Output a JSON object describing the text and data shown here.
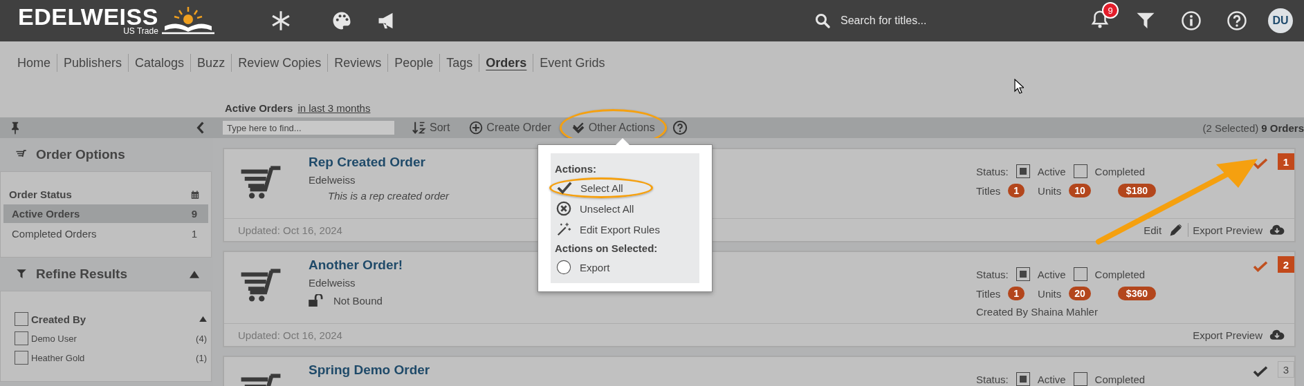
{
  "header": {
    "logo": "EDELWEISS",
    "logo_sub": "US Trade",
    "search": {
      "placeholder": "Search for titles..."
    },
    "notification_count": "9",
    "avatar": "DU"
  },
  "nav": [
    {
      "label": "Home",
      "selected": false
    },
    {
      "label": "Publishers",
      "selected": false
    },
    {
      "label": "Catalogs",
      "selected": false
    },
    {
      "label": "Buzz",
      "selected": false
    },
    {
      "label": "Review Copies",
      "selected": false
    },
    {
      "label": "Reviews",
      "selected": false
    },
    {
      "label": "People",
      "selected": false
    },
    {
      "label": "Tags",
      "selected": false
    },
    {
      "label": "Orders",
      "selected": true
    },
    {
      "label": "Event Grids",
      "selected": false
    }
  ],
  "heading": {
    "title": "Active Orders",
    "range": "in last 3 months"
  },
  "toolbar": {
    "find": {
      "placeholder": "Type here to find..."
    },
    "sort": "Sort",
    "create": "Create Order",
    "other": {
      "label": "Other Actions",
      "highlighted": true
    },
    "selected_count": "(2 Selected)",
    "total": "9 Orders"
  },
  "sidebar": {
    "order_options": "Order Options",
    "order_status": {
      "title": "Order Status",
      "items": [
        {
          "label": "Active Orders",
          "count": "9",
          "selected": true
        },
        {
          "label": "Completed Orders",
          "count": "1",
          "selected": false
        }
      ]
    },
    "refine": {
      "title": "Refine Results",
      "expanded": true,
      "groups": [
        {
          "label": "Created By",
          "checked": false,
          "expanded": true,
          "items": [
            {
              "label": "Demo User",
              "count": "(4)",
              "checked": false
            },
            {
              "label": "Heather Gold",
              "count": "(1)",
              "checked": false
            }
          ]
        }
      ]
    }
  },
  "menu": {
    "sections": [
      {
        "title": "Actions:",
        "items": [
          {
            "kind": "check",
            "label": "Select All",
            "highlighted": true
          },
          {
            "kind": "clear",
            "label": "Unselect All",
            "highlighted": false
          },
          {
            "kind": "wand",
            "label": "Edit Export Rules",
            "highlighted": false
          }
        ]
      },
      {
        "title": "Actions on Selected:",
        "items": [
          {
            "kind": "radio",
            "label": "Export",
            "highlighted": false
          }
        ]
      }
    ]
  },
  "orders": [
    {
      "title": "Rep Created Order",
      "publisher": "Edelweiss",
      "detail": {
        "kind": "note",
        "text": "This is a rep created order"
      },
      "status_label": "Status:",
      "statuses": [
        {
          "label": "Active",
          "checked": true
        },
        {
          "label": "Completed",
          "checked": false
        }
      ],
      "counts": [
        {
          "label": "Titles",
          "value": "1"
        },
        {
          "label": "Units",
          "value": "10"
        },
        {
          "value": "$180"
        }
      ],
      "updated": "Updated: Oct 16, 2024",
      "edit": "Edit",
      "export": "Export Preview",
      "selected": true,
      "index": "1"
    },
    {
      "title": "Another Order!",
      "publisher": "Edelweiss",
      "detail": {
        "kind": "binding",
        "text": "Not Bound"
      },
      "status_label": "Status:",
      "statuses": [
        {
          "label": "Active",
          "checked": true
        },
        {
          "label": "Completed",
          "checked": false
        }
      ],
      "counts": [
        {
          "label": "Titles",
          "value": "1"
        },
        {
          "label": "Units",
          "value": "20"
        },
        {
          "value": "$360"
        }
      ],
      "created_by": "Created By Shaina Mahler",
      "updated": "Updated: Oct 16, 2024",
      "export": "Export Preview",
      "selected": true,
      "index": "2"
    },
    {
      "title": "Spring Demo Order",
      "status_label": "Status:",
      "statuses": [
        {
          "label": "Active",
          "checked": true
        },
        {
          "label": "Completed",
          "checked": false
        }
      ],
      "selected": false,
      "index": "3"
    }
  ]
}
